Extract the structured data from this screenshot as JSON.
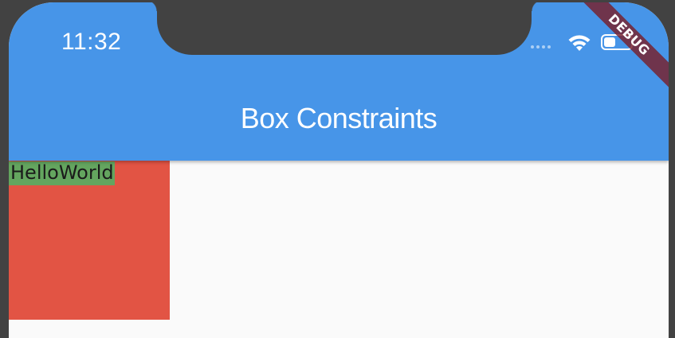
{
  "status_bar": {
    "time": "11:32",
    "icons": [
      "signal-dots-icon",
      "wifi-icon",
      "battery-icon"
    ]
  },
  "app_bar": {
    "title": "Box Constraints",
    "color": "#4795e8"
  },
  "content": {
    "red_box_color": "#e25444",
    "text": "HelloWorld",
    "text_background_color": "#64a55f"
  },
  "debug_banner": {
    "label": "DEBUG"
  }
}
